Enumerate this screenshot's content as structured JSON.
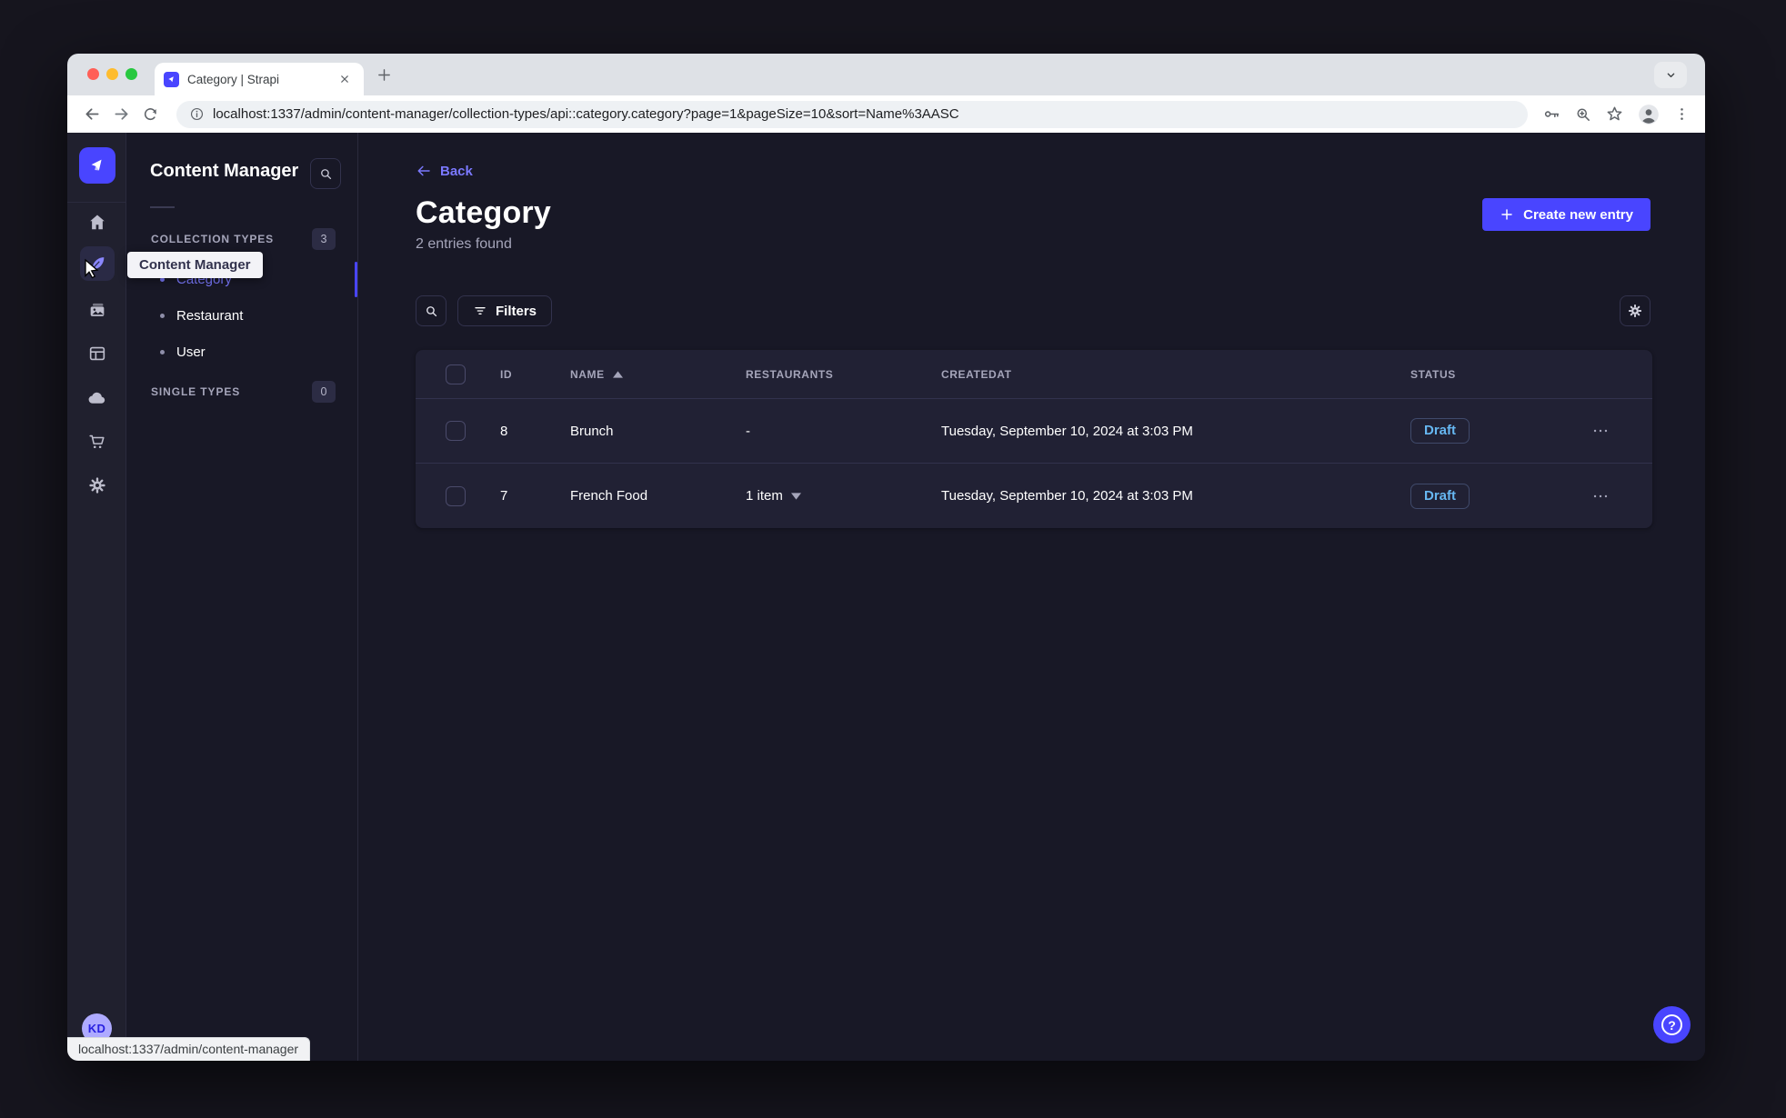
{
  "browser": {
    "tab_title": "Category | Strapi",
    "url": "localhost:1337/admin/content-manager/collection-types/api::category.category?page=1&pageSize=10&sort=Name%3AASC",
    "status_bar": "localhost:1337/admin/content-manager",
    "toolbar_icons": [
      "back-icon",
      "forward-icon",
      "reload-icon",
      "info-icon",
      "key-icon",
      "zoom-icon",
      "bookmark-star-icon",
      "profile-icon",
      "menu-icon"
    ]
  },
  "colors": {
    "primary": "#4945ff",
    "primary_light": "#7b79ff",
    "app_bg": "#181826",
    "panel_bg": "#212134",
    "muted_text": "#a5a5ba",
    "draft_text": "#66b7f1"
  },
  "sidebar": {
    "icons": [
      "home-icon",
      "content-manager-icon",
      "media-library-icon",
      "content-type-builder-icon",
      "cloud-icon",
      "marketplace-icon",
      "settings-icon"
    ],
    "active_icon": "content-manager-icon",
    "tooltip": "Content Manager",
    "avatar_initials": "KD"
  },
  "subnav": {
    "title": "Content Manager",
    "sections": [
      {
        "label": "COLLECTION TYPES",
        "badge": "3",
        "items": [
          "Category",
          "Restaurant",
          "User"
        ],
        "active_item": "Category"
      },
      {
        "label": "SINGLE TYPES",
        "badge": "0",
        "items": []
      }
    ]
  },
  "main": {
    "back_label": "Back",
    "title": "Category",
    "subtitle": "2 entries found",
    "create_label": "Create new entry",
    "filters_label": "Filters",
    "help_glyph": "?"
  },
  "table": {
    "headers": [
      "ID",
      "NAME",
      "RESTAURANTS",
      "CREATEDAT",
      "STATUS"
    ],
    "sorted_by": "NAME",
    "sort_direction": "ASC",
    "rows": [
      {
        "id": "8",
        "name": "Brunch",
        "restaurants": "-",
        "created": "Tuesday, September 10, 2024 at 3:03 PM",
        "status": "Draft"
      },
      {
        "id": "7",
        "name": "French Food",
        "restaurants": "1 item",
        "created": "Tuesday, September 10, 2024 at 3:03 PM",
        "status": "Draft"
      }
    ]
  }
}
